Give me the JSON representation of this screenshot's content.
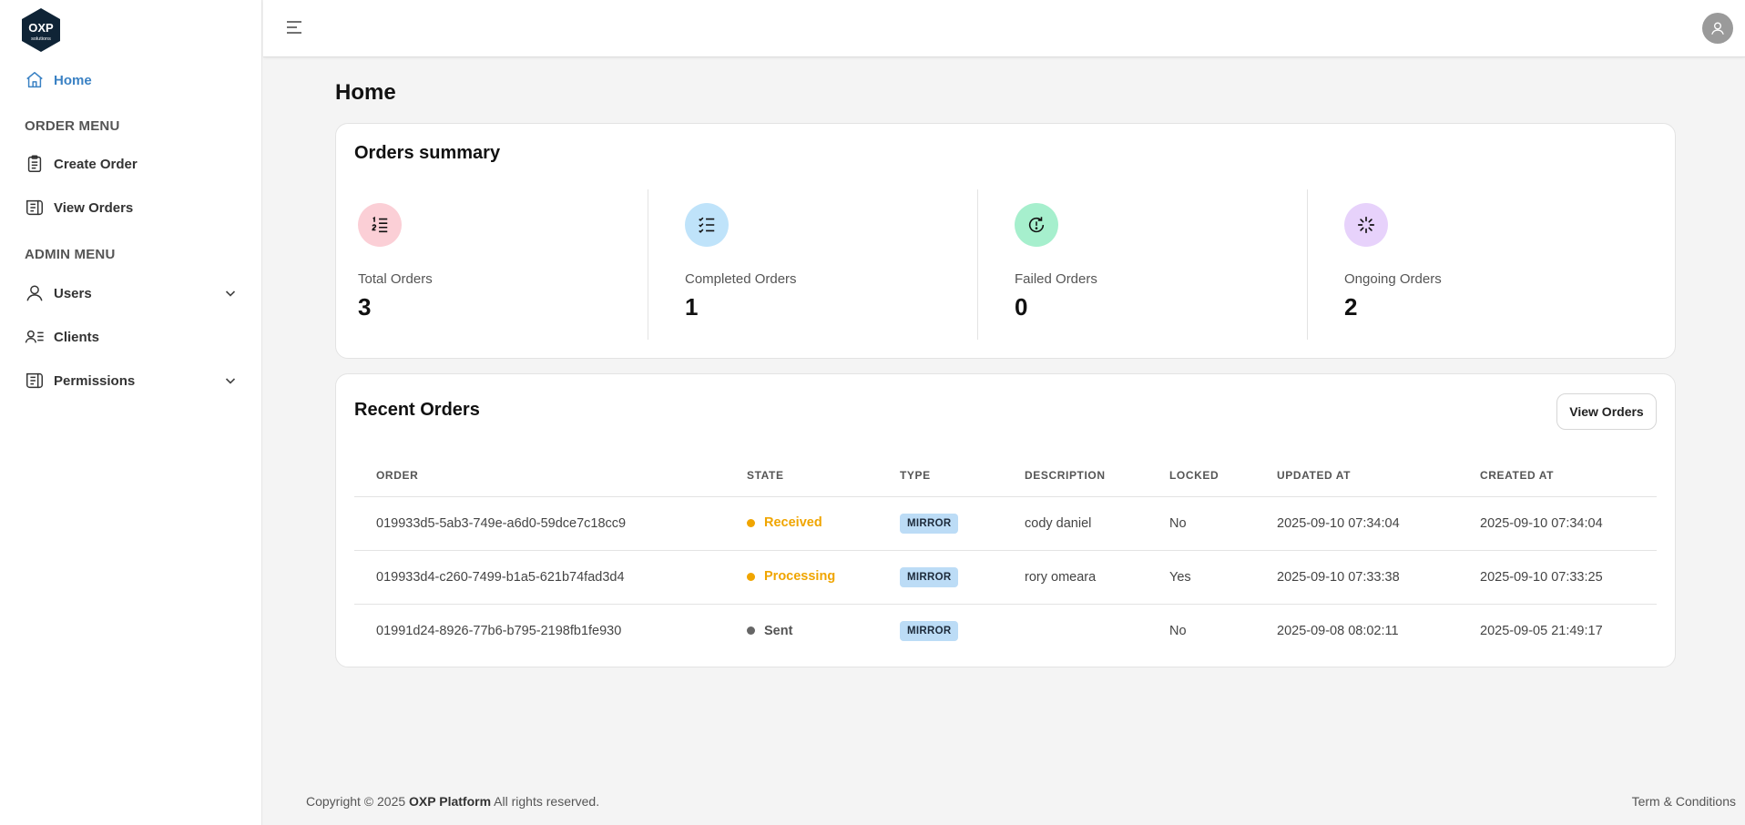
{
  "brand": {
    "logo_text": "OXP",
    "logo_sub": "solutions"
  },
  "sidebar": {
    "home": "Home",
    "order_menu_title": "ORDER MENU",
    "create_order": "Create Order",
    "view_orders": "View Orders",
    "admin_menu_title": "ADMIN MENU",
    "users": "Users",
    "clients": "Clients",
    "permissions": "Permissions"
  },
  "page": {
    "title": "Home"
  },
  "summary": {
    "title": "Orders summary",
    "stats": [
      {
        "label": "Total Orders",
        "value": "3",
        "icon": "numbered-list-icon",
        "color": "#fbcfd6"
      },
      {
        "label": "Completed Orders",
        "value": "1",
        "icon": "checklist-icon",
        "color": "#bfe3fa"
      },
      {
        "label": "Failed Orders",
        "value": "0",
        "icon": "refresh-alert-icon",
        "color": "#a6efcd"
      },
      {
        "label": "Ongoing Orders",
        "value": "2",
        "icon": "spinner-icon",
        "color": "#e7d2fb"
      }
    ]
  },
  "recent": {
    "title": "Recent Orders",
    "view_button": "View Orders",
    "columns": [
      "ORDER",
      "STATE",
      "TYPE",
      "DESCRIPTION",
      "LOCKED",
      "UPDATED AT",
      "CREATED AT"
    ],
    "rows": [
      {
        "order": "019933d5-5ab3-749e-a6d0-59dce7c18cc9",
        "state": "Received",
        "state_color": "#f0a500",
        "type": "MIRROR",
        "description": "cody daniel",
        "locked": "No",
        "updated": "2025-09-10 07:34:04",
        "created": "2025-09-10 07:34:04"
      },
      {
        "order": "019933d4-c260-7499-b1a5-621b74fad3d4",
        "state": "Processing",
        "state_color": "#f0a500",
        "type": "MIRROR",
        "description": "rory omeara",
        "locked": "Yes",
        "updated": "2025-09-10 07:33:38",
        "created": "2025-09-10 07:33:25"
      },
      {
        "order": "01991d24-8926-77b6-b795-2198fb1fe930",
        "state": "Sent",
        "state_color": "#666666",
        "type": "MIRROR",
        "description": "",
        "locked": "No",
        "updated": "2025-09-08 08:02:11",
        "created": "2025-09-05 21:49:17"
      }
    ]
  },
  "footer": {
    "prefix": "Copyright © 2025",
    "brand": "OXP Platform",
    "suffix": "All rights reserved.",
    "terms": "Term & Conditions"
  },
  "colors": {
    "accent": "#3b82c4",
    "sidebar_bg": "#ffffff",
    "page_bg": "#f4f4f4"
  }
}
